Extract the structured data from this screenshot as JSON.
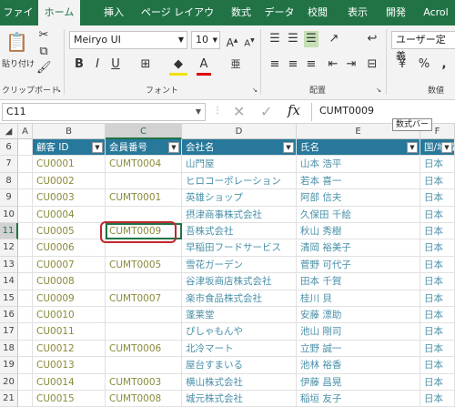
{
  "ribbon": {
    "tabs": [
      "ファイル",
      "ホーム",
      "挿入",
      "ページ レイアウト",
      "数式",
      "データ",
      "校閲",
      "表示",
      "開発",
      "Acrol"
    ],
    "active_tab": "ホーム",
    "paste_label": "貼り付け",
    "font_name": "Meiryo UI",
    "font_size": "10",
    "increase_font": "A",
    "decrease_font": "A",
    "bold": "B",
    "italic": "I",
    "underline": "U",
    "font_color_letter": "A",
    "accent_color": "#217346",
    "format_box": "ユーザー定義",
    "currency_glyph": "¥",
    "percent_glyph": "%",
    "comma_glyph": ",",
    "number_label_partial": "数値",
    "groups": {
      "clipboard": "クリップボード",
      "font": "フォント",
      "alignment": "配置",
      "number": "数値"
    }
  },
  "formula_bar": {
    "name_box": "C11",
    "fx": "fx",
    "content": "CUMT0009",
    "tooltip": "数式バー"
  },
  "grid": {
    "columns": [
      "A",
      "B",
      "C",
      "D",
      "E",
      "F"
    ],
    "selected_column": "C",
    "header_row_number": "6",
    "headers": [
      "顧客 ID",
      "会員番号",
      "会社名",
      "氏名",
      "国/地域"
    ],
    "selected_row": "11",
    "rows": [
      {
        "num": "7",
        "id": "CU0001",
        "member": "CUMT0004",
        "company": "山門屋",
        "name": "山本 浩平",
        "country": "日本"
      },
      {
        "num": "8",
        "id": "CU0002",
        "member": "",
        "company": "ヒロコーポレーション",
        "name": "若本 喜一",
        "country": "日本"
      },
      {
        "num": "9",
        "id": "CU0003",
        "member": "CUMT0001",
        "company": "英雄ショップ",
        "name": "阿部 信夫",
        "country": "日本"
      },
      {
        "num": "10",
        "id": "CU0004",
        "member": "",
        "company": "摂津商事株式会社",
        "name": "久保田 千絵",
        "country": "日本"
      },
      {
        "num": "11",
        "id": "CU0005",
        "member": "CUMT0009",
        "company": "吾株式会社",
        "name": "秋山 秀樹",
        "country": "日本"
      },
      {
        "num": "12",
        "id": "CU0006",
        "member": "",
        "company": "早稲田フードサービス",
        "name": "清岡 裕美子",
        "country": "日本"
      },
      {
        "num": "13",
        "id": "CU0007",
        "member": "CUMT0005",
        "company": "雪花ガーデン",
        "name": "菅野 可代子",
        "country": "日本"
      },
      {
        "num": "14",
        "id": "CU0008",
        "member": "",
        "company": "谷津坂商店株式会社",
        "name": "田本 千賀",
        "country": "日本"
      },
      {
        "num": "15",
        "id": "CU0009",
        "member": "CUMT0007",
        "company": "楽市食品株式会社",
        "name": "桂川 貝",
        "country": "日本"
      },
      {
        "num": "16",
        "id": "CU0010",
        "member": "",
        "company": "蓬莱堂",
        "name": "安藤 漂助",
        "country": "日本"
      },
      {
        "num": "17",
        "id": "CU0011",
        "member": "",
        "company": "ぴしゃもんや",
        "name": "池山 剛司",
        "country": "日本"
      },
      {
        "num": "18",
        "id": "CU0012",
        "member": "CUMT0006",
        "company": "北冷マート",
        "name": "立野 誠一",
        "country": "日本"
      },
      {
        "num": "19",
        "id": "CU0013",
        "member": "",
        "company": "屋台すまいる",
        "name": "池林 裕香",
        "country": "日本"
      },
      {
        "num": "20",
        "id": "CU0014",
        "member": "CUMT0003",
        "company": "横山株式会社",
        "name": "伊藤 昌晃",
        "country": "日本"
      },
      {
        "num": "21",
        "id": "CU0015",
        "member": "CUMT0008",
        "company": "城元株式会社",
        "name": "稲垣 友子",
        "country": "日本"
      }
    ]
  },
  "colors": {
    "header_fill": "#27789a",
    "id_text": "#8a8a3c",
    "body_text": "#4a90a8",
    "highlight_ring": "#c0272d"
  }
}
